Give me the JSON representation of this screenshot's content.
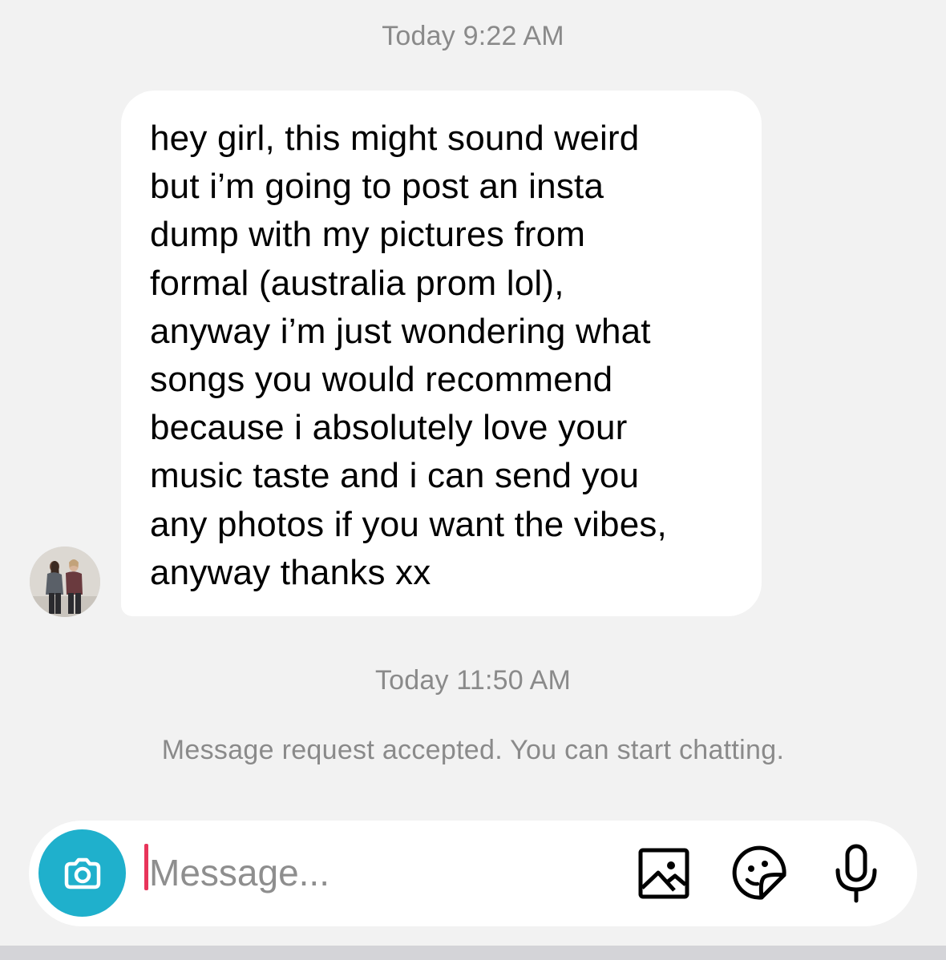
{
  "thread": {
    "timestamp_first": "Today 9:22 AM",
    "incoming_message": "hey girl, this might sound weird\nbut i’m going to post an insta\ndump with my pictures from\nformal (australia prom lol),\nanyway i’m just wondering what\nsongs you would recommend\nbecause i absolutely love your\nmusic taste and i can send you\nany photos if you want the vibes,\nanyway thanks xx",
    "timestamp_second": "Today 11:50 AM",
    "notice": "Message request accepted. You can start chatting."
  },
  "composer": {
    "placeholder": "Message...",
    "value": "",
    "icons": {
      "camera": "camera-icon",
      "gallery": "image-icon",
      "sticker": "sticker-icon",
      "mic": "microphone-icon"
    },
    "colors": {
      "camera_button": "#1fb0cc",
      "cursor": "#e8345a"
    }
  }
}
